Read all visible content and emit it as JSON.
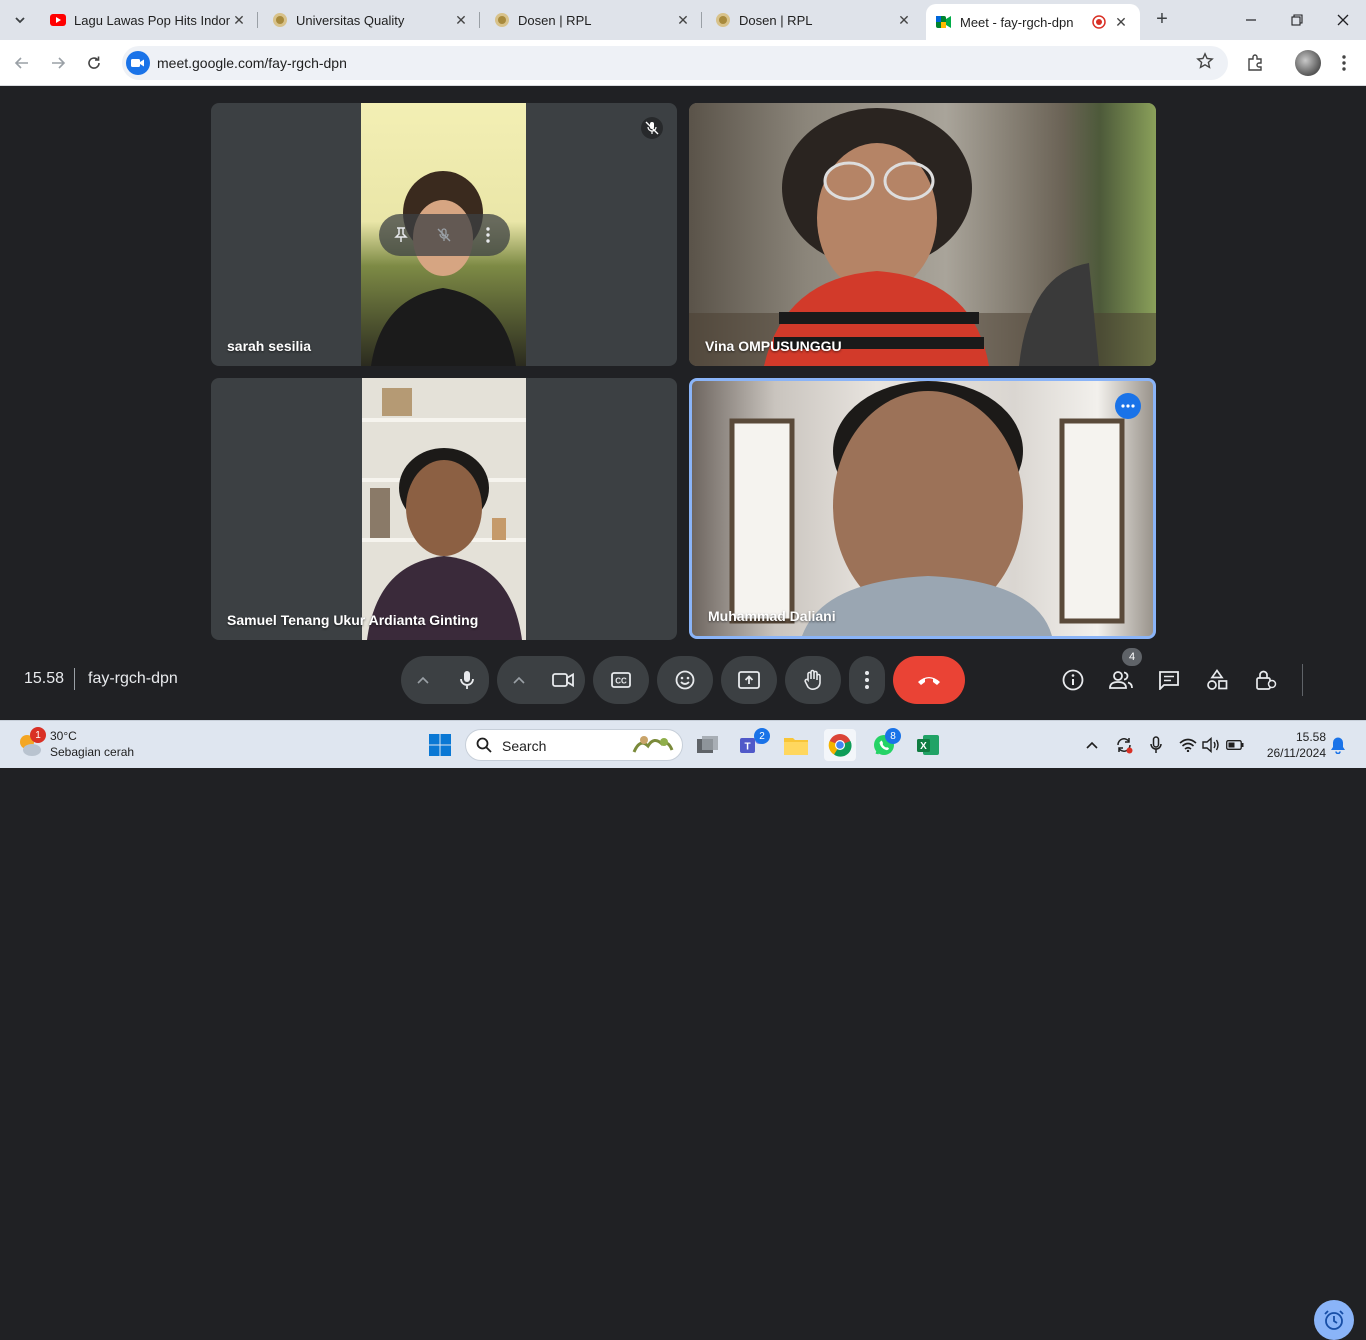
{
  "browser": {
    "tabs": [
      {
        "title": "Lagu Lawas Pop Hits Indonesia",
        "favicon": "youtube-icon",
        "active": false
      },
      {
        "title": "Universitas Quality",
        "favicon": "university-seal-icon",
        "active": false
      },
      {
        "title": "Dosen | RPL",
        "favicon": "university-seal-icon",
        "active": false
      },
      {
        "title": "Dosen | RPL",
        "favicon": "university-seal-icon",
        "active": false
      },
      {
        "title": "Meet - fay-rgch-dpn",
        "favicon": "meet-icon",
        "active": true
      }
    ],
    "close_glyph": "✕",
    "new_tab_glyph": "+",
    "url": "meet.google.com/fay-rgch-dpn"
  },
  "meet": {
    "participants": [
      {
        "name": "sarah sesilia",
        "muted": true
      },
      {
        "name": "Vina OMPUSUNGGU",
        "muted": false
      },
      {
        "name": "Samuel Tenang Ukur Ardianta Ginting",
        "muted": false
      },
      {
        "name": "Muhammad Daliani",
        "muted": false,
        "speaking": true
      }
    ],
    "time": "15.58",
    "meeting_code": "fay-rgch-dpn",
    "people_count": "4"
  },
  "taskbar": {
    "weather_badge": "1",
    "temperature": "30°C",
    "weather_desc": "Sebagian cerah",
    "search_label": "Search",
    "teams_badge": "2",
    "whatsapp_badge": "8",
    "time": "15.58",
    "date": "26/11/2024"
  },
  "colors": {
    "accent": "#1a73e8",
    "end_call": "#ea4335",
    "meet_bg": "#202124",
    "tile_bg": "#3c4043",
    "speaking_border": "#8ab4f8"
  }
}
